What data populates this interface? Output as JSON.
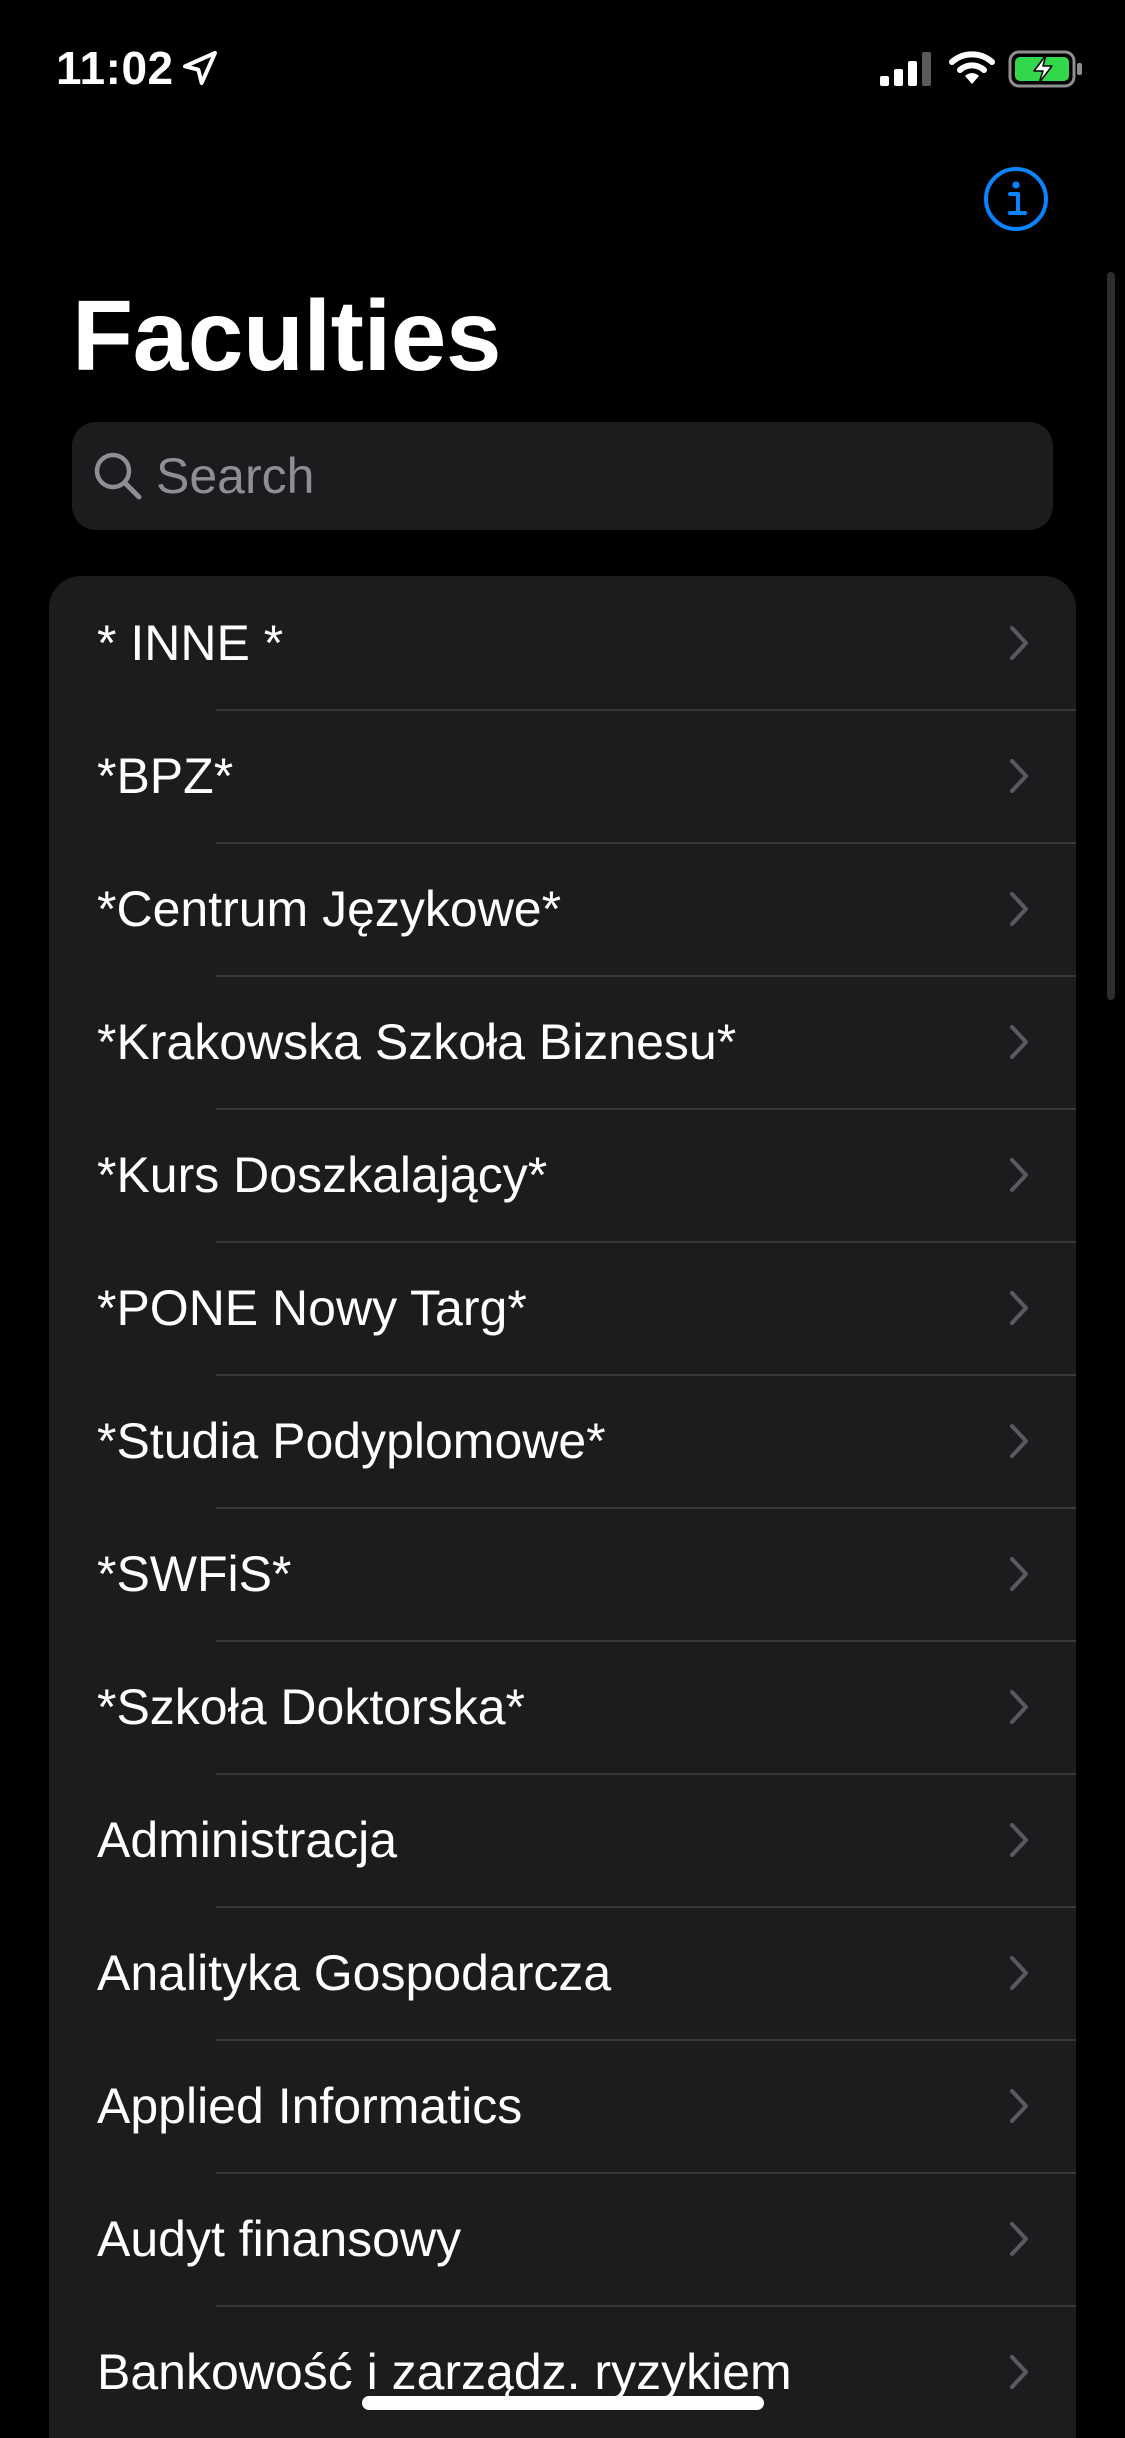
{
  "status_bar": {
    "time": "11:02",
    "icons": [
      "location-arrow-icon",
      "cellular-signal-icon",
      "wifi-icon",
      "battery-charging-icon"
    ],
    "battery_color": "#32d74b"
  },
  "header": {
    "title": "Faculties",
    "info_icon": "info-circle-icon",
    "accent_color": "#0a84ff"
  },
  "search": {
    "placeholder": "Search",
    "value": ""
  },
  "faculties": [
    {
      "label": "* INNE *"
    },
    {
      "label": "*BPZ*"
    },
    {
      "label": "*Centrum Językowe*"
    },
    {
      "label": "*Krakowska Szkoła Biznesu*"
    },
    {
      "label": "*Kurs Doszkalający*"
    },
    {
      "label": "*PONE Nowy Targ*"
    },
    {
      "label": "*Studia Podyplomowe*"
    },
    {
      "label": "*SWFiS*"
    },
    {
      "label": "*Szkoła Doktorska*"
    },
    {
      "label": "Administracja"
    },
    {
      "label": "Analityka Gospodarcza"
    },
    {
      "label": "Applied Informatics"
    },
    {
      "label": "Audyt finansowy"
    },
    {
      "label": "Bankowość i zarządz. ryzykiem"
    }
  ]
}
